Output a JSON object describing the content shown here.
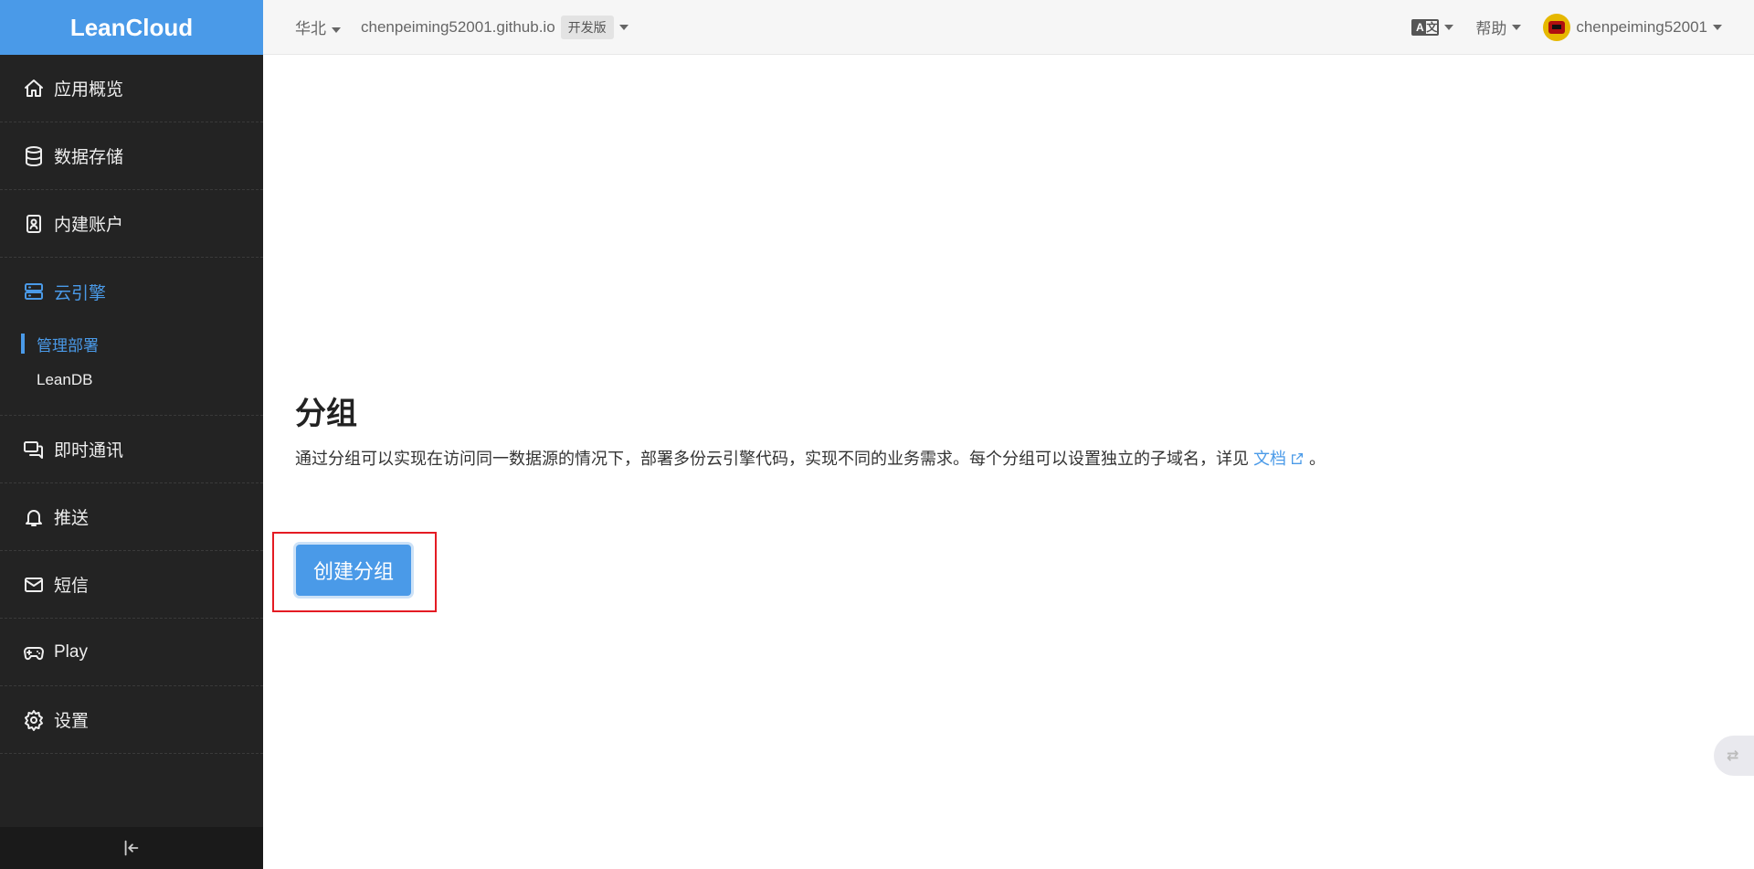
{
  "sidebar": {
    "logo": "LeanCloud",
    "items": [
      {
        "label": "应用概览",
        "icon": "home-icon"
      },
      {
        "label": "数据存储",
        "icon": "database-icon"
      },
      {
        "label": "内建账户",
        "icon": "id-card-icon"
      },
      {
        "label": "云引擎",
        "icon": "server-icon",
        "active": true
      },
      {
        "label": "即时通讯",
        "icon": "chat-icon"
      },
      {
        "label": "推送",
        "icon": "bell-icon"
      },
      {
        "label": "短信",
        "icon": "mail-icon"
      },
      {
        "label": "Play",
        "icon": "gamepad-icon"
      },
      {
        "label": "设置",
        "icon": "gear-icon"
      }
    ],
    "subitems": [
      {
        "label": "管理部署",
        "active": true
      },
      {
        "label": "LeanDB"
      }
    ]
  },
  "topbar": {
    "region": "华北",
    "app_name": "chenpeiming52001.github.io",
    "plan_badge": "开发版",
    "lang_a": "A",
    "lang_b": "文",
    "help": "帮助",
    "username": "chenpeiming52001"
  },
  "main": {
    "title": "分组",
    "description": "通过分组可以实现在访问同一数据源的情况下，部署多份云引擎代码，实现不同的业务需求。每个分组可以设置独立的子域名，详见",
    "doc_link": "文档",
    "description_end": "。",
    "create_button": "创建分组"
  },
  "colors": {
    "accent": "#4a9ae8",
    "sidebar_bg": "#232323",
    "highlight_border": "#e41b23"
  }
}
